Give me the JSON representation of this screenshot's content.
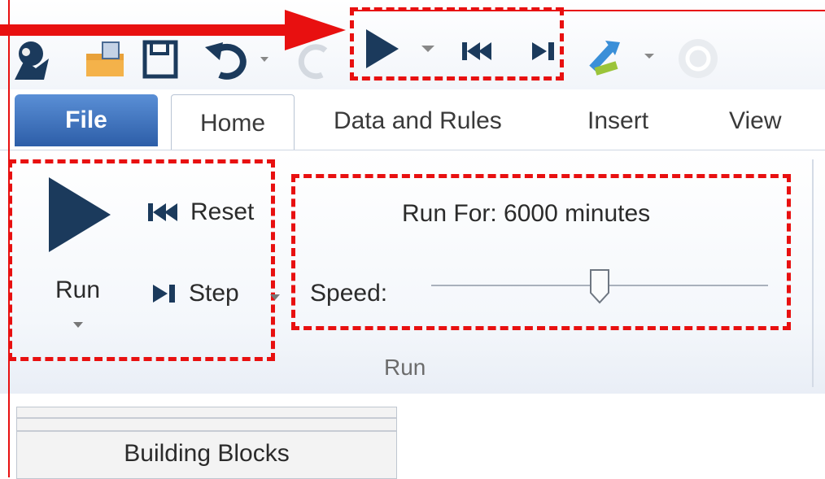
{
  "tabs": {
    "file": "File",
    "home": "Home",
    "data_rules": "Data and Rules",
    "insert": "Insert",
    "view": "View"
  },
  "run_group": {
    "run_label": "Run",
    "reset_label": "Reset",
    "step_label": "Step",
    "group_label": "Run"
  },
  "run_for": {
    "text": "Run For: 6000 minutes"
  },
  "speed": {
    "label": "Speed:",
    "value": 0.5
  },
  "panel": {
    "building_blocks": "Building Blocks"
  },
  "colors": {
    "highlight": "#e81010",
    "icon_blue": "#1b3a5c",
    "file_tab": "#2d5ea8"
  }
}
